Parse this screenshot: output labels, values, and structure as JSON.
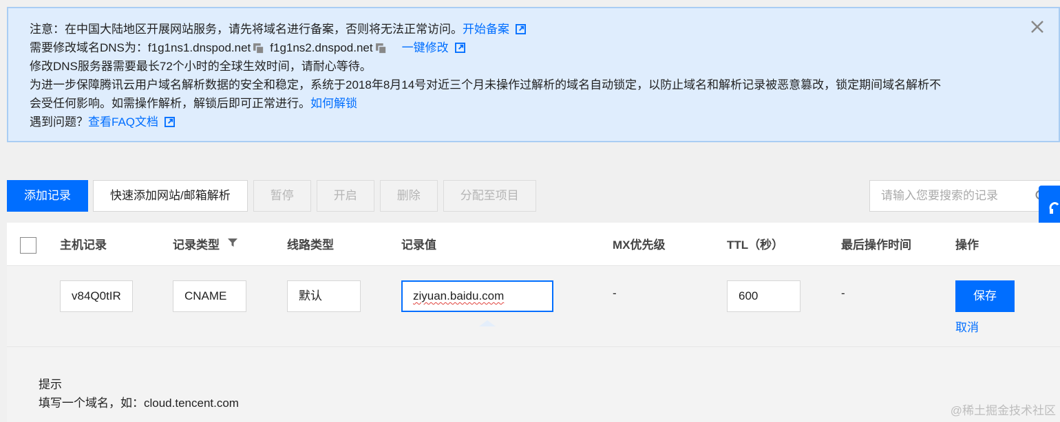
{
  "notice": {
    "line1_text": "注意：在中国大陆地区开展网站服务，请先将域名进行备案，否则将无法正常访问。",
    "line1_link": "开始备案",
    "line2_prefix": "需要修改域名DNS为：",
    "ns1": "f1g1ns1.dnspod.net",
    "ns2": "f1g1ns2.dnspod.net",
    "line2_link": "一键修改",
    "line3": "修改DNS服务器需要最长72个小时的全球生效时间，请耐心等待。",
    "line4": "为进一步保障腾讯云用户域名解析数据的安全和稳定，系统于2018年8月14号对近三个月未操作过解析的域名自动锁定，以防止域名和解析记录被恶意篡改，锁定期间域名解析不",
    "line5_text": "会受任何影响。如需操作解析，解锁后即可正常进行。",
    "line5_link": "如何解锁",
    "line6_text": "遇到问题？",
    "line6_link": "查看FAQ文档"
  },
  "toolbar": {
    "add_record": "添加记录",
    "quick_add": "快速添加网站/邮箱解析",
    "pause": "暂停",
    "enable": "开启",
    "delete": "删除",
    "assign_project": "分配至项目"
  },
  "search": {
    "placeholder": "请输入您要搜索的记录"
  },
  "table": {
    "headers": {
      "host": "主机记录",
      "record_type": "记录类型",
      "line_type": "线路类型",
      "record_value": "记录值",
      "mx_priority": "MX优先级",
      "ttl": "TTL（秒）",
      "last_modified": "最后操作时间",
      "actions": "操作"
    },
    "edit_row": {
      "host": "v84Q0tIR",
      "record_type": "CNAME",
      "line_type": "默认",
      "record_value": "ziyuan.baidu.com",
      "mx_priority": "-",
      "ttl": "600",
      "last_modified": "-",
      "save": "保存",
      "cancel": "取消"
    },
    "hint": {
      "title": "提示",
      "text": "填写一个域名，如：cloud.tencent.com"
    }
  },
  "watermark": "@稀土掘金技术社区",
  "colors": {
    "accent": "#006eff",
    "notice_bg": "#dfedfd",
    "notice_border": "#a9cdf3"
  }
}
